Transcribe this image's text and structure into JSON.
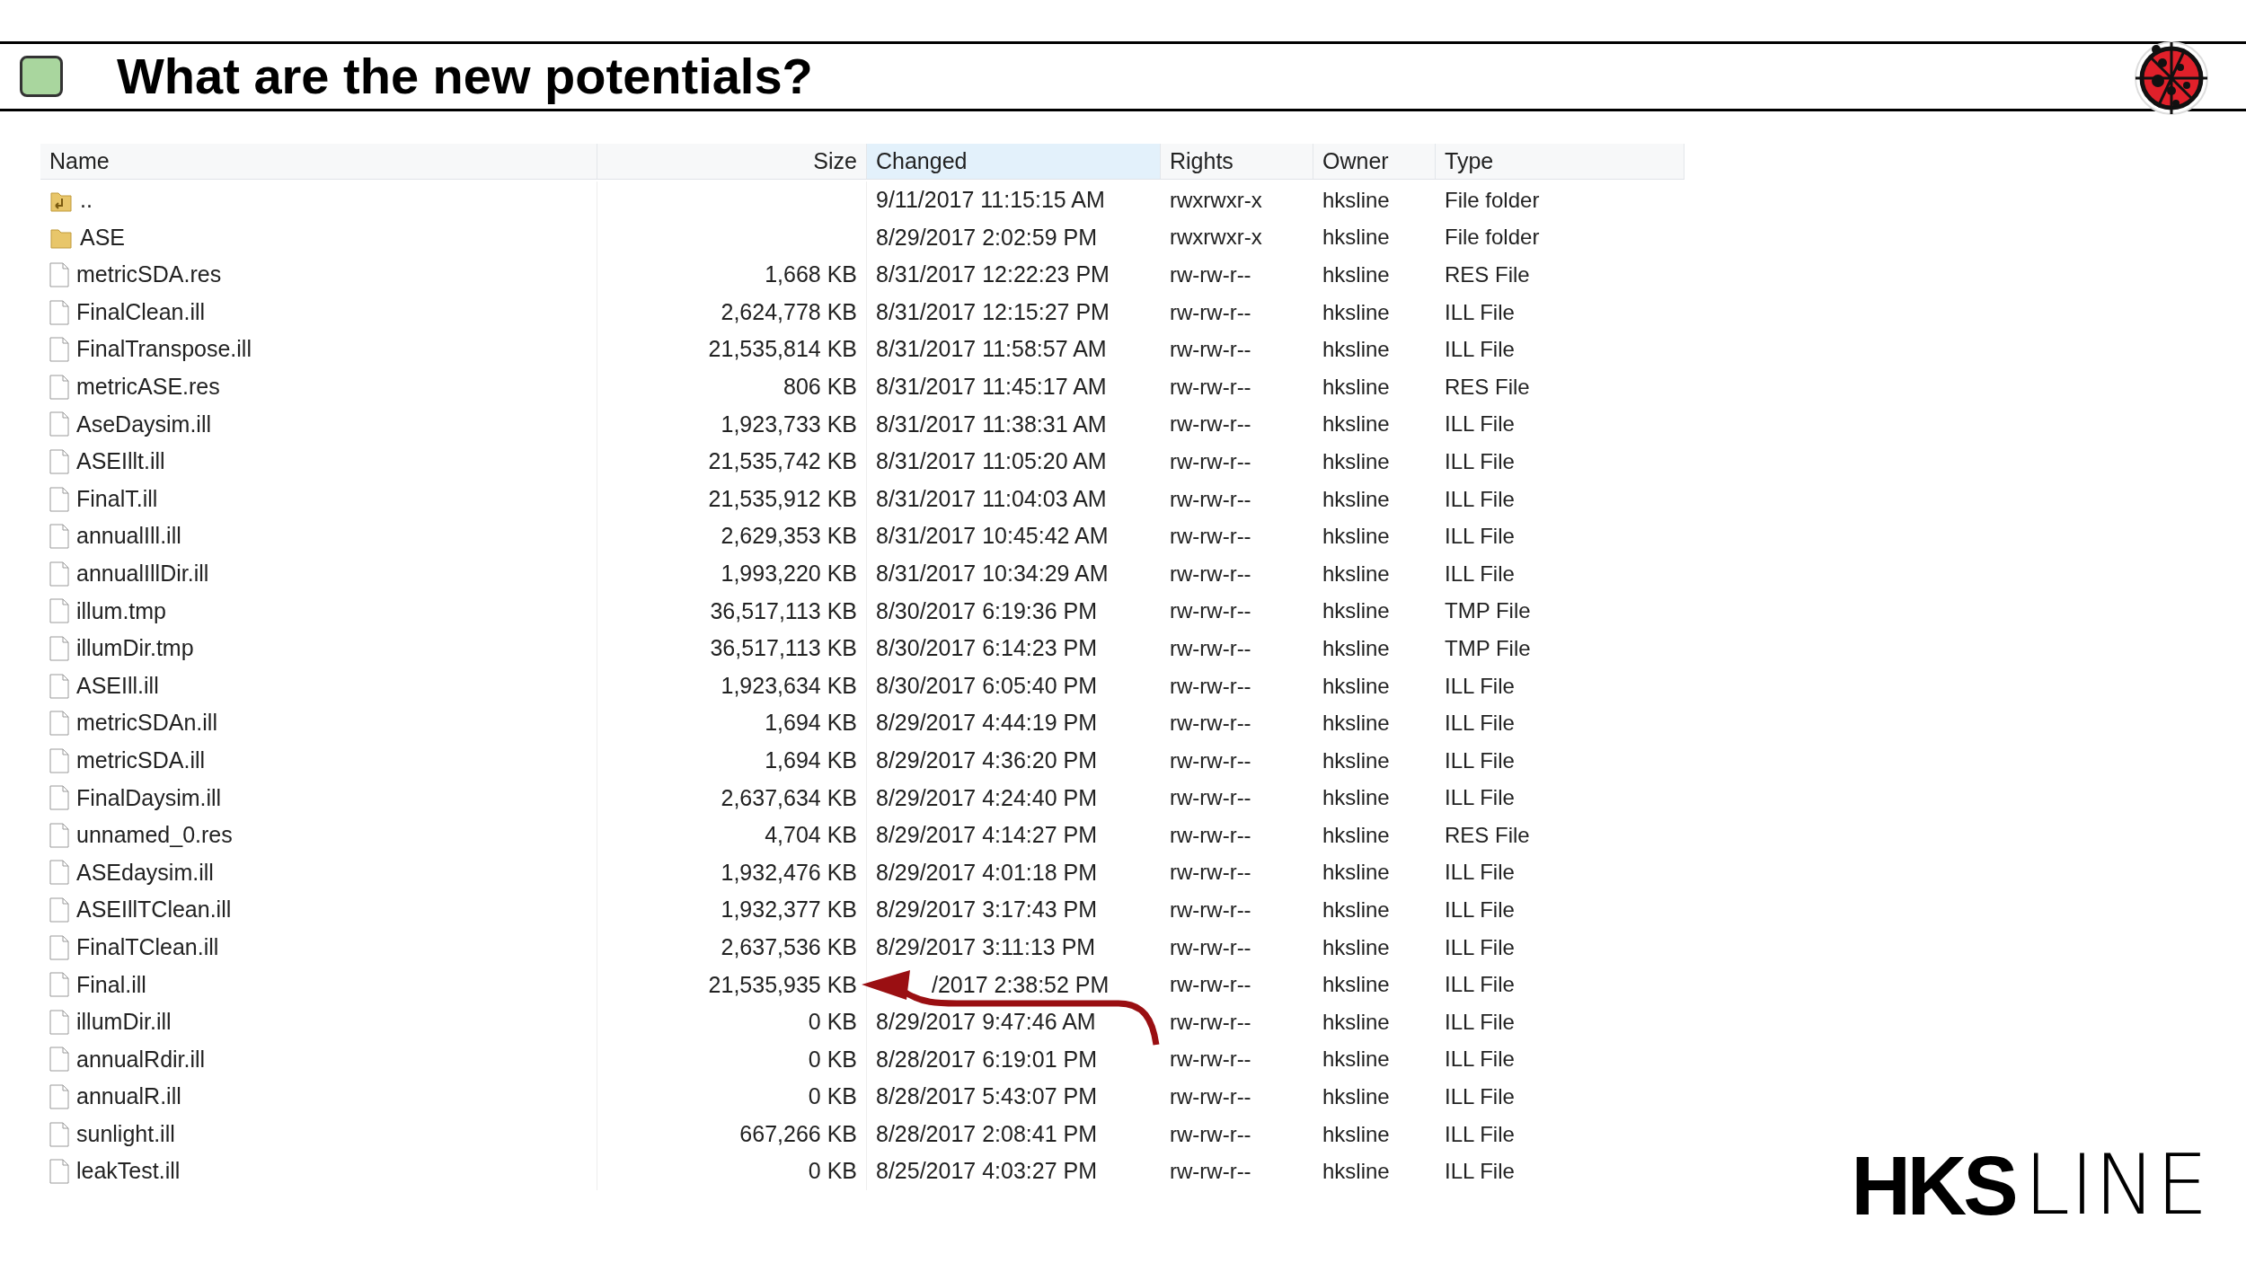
{
  "slide": {
    "title": "What are the new potentials?"
  },
  "table": {
    "columns": [
      {
        "label": "Name",
        "selected": false
      },
      {
        "label": "Size",
        "selected": false
      },
      {
        "label": "Changed",
        "selected": true
      },
      {
        "label": "Rights",
        "selected": false
      },
      {
        "label": "Owner",
        "selected": false
      },
      {
        "label": "Type",
        "selected": false
      }
    ],
    "rows": [
      {
        "kind": "up",
        "name": "..",
        "size": "",
        "changed": "9/11/2017 11:15:15 AM",
        "rights": "rwxrwxr-x",
        "owner": "hksline",
        "type": "File folder"
      },
      {
        "kind": "folder",
        "name": "ASE",
        "size": "",
        "changed": "8/29/2017 2:02:59 PM",
        "rights": "rwxrwxr-x",
        "owner": "hksline",
        "type": "File folder"
      },
      {
        "kind": "file",
        "name": "metricSDA.res",
        "size": "1,668 KB",
        "changed": "8/31/2017 12:22:23 PM",
        "rights": "rw-rw-r--",
        "owner": "hksline",
        "type": "RES File"
      },
      {
        "kind": "file",
        "name": "FinalClean.ill",
        "size": "2,624,778 KB",
        "changed": "8/31/2017 12:15:27 PM",
        "rights": "rw-rw-r--",
        "owner": "hksline",
        "type": "ILL File"
      },
      {
        "kind": "file",
        "name": "FinalTranspose.ill",
        "size": "21,535,814 KB",
        "changed": "8/31/2017 11:58:57 AM",
        "rights": "rw-rw-r--",
        "owner": "hksline",
        "type": "ILL File"
      },
      {
        "kind": "file",
        "name": "metricASE.res",
        "size": "806 KB",
        "changed": "8/31/2017 11:45:17 AM",
        "rights": "rw-rw-r--",
        "owner": "hksline",
        "type": "RES File"
      },
      {
        "kind": "file",
        "name": "AseDaysim.ill",
        "size": "1,923,733 KB",
        "changed": "8/31/2017 11:38:31 AM",
        "rights": "rw-rw-r--",
        "owner": "hksline",
        "type": "ILL File"
      },
      {
        "kind": "file",
        "name": "ASEIllt.ill",
        "size": "21,535,742 KB",
        "changed": "8/31/2017 11:05:20 AM",
        "rights": "rw-rw-r--",
        "owner": "hksline",
        "type": "ILL File"
      },
      {
        "kind": "file",
        "name": "FinalT.ill",
        "size": "21,535,912 KB",
        "changed": "8/31/2017 11:04:03 AM",
        "rights": "rw-rw-r--",
        "owner": "hksline",
        "type": "ILL File"
      },
      {
        "kind": "file",
        "name": "annualIll.ill",
        "size": "2,629,353 KB",
        "changed": "8/31/2017 10:45:42 AM",
        "rights": "rw-rw-r--",
        "owner": "hksline",
        "type": "ILL File"
      },
      {
        "kind": "file",
        "name": "annualIllDir.ill",
        "size": "1,993,220 KB",
        "changed": "8/31/2017 10:34:29 AM",
        "rights": "rw-rw-r--",
        "owner": "hksline",
        "type": "ILL File"
      },
      {
        "kind": "file",
        "name": "illum.tmp",
        "size": "36,517,113 KB",
        "changed": "8/30/2017 6:19:36 PM",
        "rights": "rw-rw-r--",
        "owner": "hksline",
        "type": "TMP File"
      },
      {
        "kind": "file",
        "name": "illumDir.tmp",
        "size": "36,517,113 KB",
        "changed": "8/30/2017 6:14:23 PM",
        "rights": "rw-rw-r--",
        "owner": "hksline",
        "type": "TMP File"
      },
      {
        "kind": "file",
        "name": "ASEIll.ill",
        "size": "1,923,634 KB",
        "changed": "8/30/2017 6:05:40 PM",
        "rights": "rw-rw-r--",
        "owner": "hksline",
        "type": "ILL File"
      },
      {
        "kind": "file",
        "name": "metricSDAn.ill",
        "size": "1,694 KB",
        "changed": "8/29/2017 4:44:19 PM",
        "rights": "rw-rw-r--",
        "owner": "hksline",
        "type": "ILL File"
      },
      {
        "kind": "file",
        "name": "metricSDA.ill",
        "size": "1,694 KB",
        "changed": "8/29/2017 4:36:20 PM",
        "rights": "rw-rw-r--",
        "owner": "hksline",
        "type": "ILL File"
      },
      {
        "kind": "file",
        "name": "FinalDaysim.ill",
        "size": "2,637,634 KB",
        "changed": "8/29/2017 4:24:40 PM",
        "rights": "rw-rw-r--",
        "owner": "hksline",
        "type": "ILL File"
      },
      {
        "kind": "file",
        "name": "unnamed_0.res",
        "size": "4,704 KB",
        "changed": "8/29/2017 4:14:27 PM",
        "rights": "rw-rw-r--",
        "owner": "hksline",
        "type": "RES File"
      },
      {
        "kind": "file",
        "name": "ASEdaysim.ill",
        "size": "1,932,476 KB",
        "changed": "8/29/2017 4:01:18 PM",
        "rights": "rw-rw-r--",
        "owner": "hksline",
        "type": "ILL File"
      },
      {
        "kind": "file",
        "name": "ASEIllTClean.ill",
        "size": "1,932,377 KB",
        "changed": "8/29/2017 3:17:43 PM",
        "rights": "rw-rw-r--",
        "owner": "hksline",
        "type": "ILL File"
      },
      {
        "kind": "file",
        "name": "FinalTClean.ill",
        "size": "2,637,536 KB",
        "changed": "8/29/2017 3:11:13 PM",
        "rights": "rw-rw-r--",
        "owner": "hksline",
        "type": "ILL File"
      },
      {
        "kind": "file",
        "name": "Final.ill",
        "size": "21,535,935 KB",
        "changed": "/2017 2:38:52 PM",
        "rights": "rw-rw-r--",
        "owner": "hksline",
        "type": "ILL File"
      },
      {
        "kind": "file",
        "name": "illumDir.ill",
        "size": "0 KB",
        "changed": "8/29/2017 9:47:46 AM",
        "rights": "rw-rw-r--",
        "owner": "hksline",
        "type": "ILL File"
      },
      {
        "kind": "file",
        "name": "annualRdir.ill",
        "size": "0 KB",
        "changed": "8/28/2017 6:19:01 PM",
        "rights": "rw-rw-r--",
        "owner": "hksline",
        "type": "ILL File"
      },
      {
        "kind": "file",
        "name": "annualR.ill",
        "size": "0 KB",
        "changed": "8/28/2017 5:43:07 PM",
        "rights": "rw-rw-r--",
        "owner": "hksline",
        "type": "ILL File"
      },
      {
        "kind": "file",
        "name": "sunlight.ill",
        "size": "667,266 KB",
        "changed": "8/28/2017 2:08:41 PM",
        "rights": "rw-rw-r--",
        "owner": "hksline",
        "type": "ILL File"
      },
      {
        "kind": "file",
        "name": "leakTest.ill",
        "size": "0 KB",
        "changed": "8/25/2017 4:03:27 PM",
        "rights": "rw-rw-r--",
        "owner": "hksline",
        "type": "ILL File"
      }
    ]
  },
  "logo": {
    "bold": "HKS",
    "light": "LINE"
  }
}
